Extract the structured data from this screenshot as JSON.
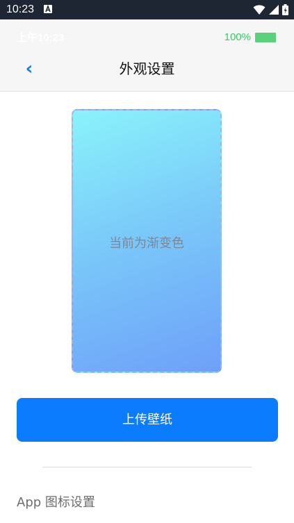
{
  "system_bar": {
    "time": "10:23",
    "notification_icon": "text-a-icon",
    "icons": [
      "wifi-icon",
      "cell-signal-icon",
      "battery-icon"
    ]
  },
  "header": {
    "fake_status_time": "上午10:23",
    "battery_text": "100%",
    "back_icon": "chevron-left-icon",
    "back_label": "‹",
    "title": "外观设置"
  },
  "preview": {
    "text": "当前为渐变色",
    "gradient_colors": [
      "#8af3fb",
      "#6ea0f9"
    ]
  },
  "upload_button": {
    "label": "上传壁纸",
    "color": "#0b7cfd"
  },
  "sections": {
    "app_icon_title": "App 图标设置"
  }
}
